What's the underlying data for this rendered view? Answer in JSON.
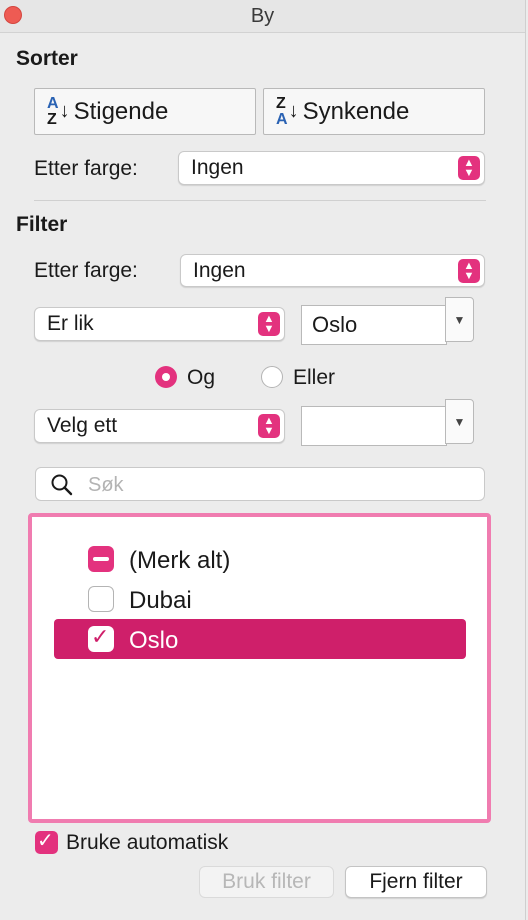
{
  "window": {
    "title": "By"
  },
  "sort": {
    "heading": "Sorter",
    "ascending_label": "Stigende",
    "descending_label": "Synkende",
    "by_color_label": "Etter farge:",
    "by_color_value": "Ingen"
  },
  "filter": {
    "heading": "Filter",
    "by_color_label": "Etter farge:",
    "by_color_value": "Ingen",
    "condition1": {
      "operator": "Er lik",
      "value": "Oslo"
    },
    "logic": {
      "and_label": "Og",
      "or_label": "Eller",
      "selected": "Og"
    },
    "condition2": {
      "operator": "Velg ett",
      "value": ""
    }
  },
  "search": {
    "placeholder": "Søk",
    "value": ""
  },
  "list": {
    "items": [
      {
        "label": "(Merk alt)",
        "state": "mixed"
      },
      {
        "label": "Dubai",
        "state": "unchecked"
      },
      {
        "label": "Oslo",
        "state": "checked",
        "selected": true
      }
    ]
  },
  "footer": {
    "auto_apply_label": "Bruke automatisk",
    "auto_apply_checked": true,
    "apply_button": "Bruk filter",
    "clear_button": "Fjern filter"
  },
  "colors": {
    "accent": "#e3327e",
    "selection": "#cf1f6a",
    "focus_ring": "#f07cb0"
  },
  "icons": [
    "close-icon",
    "sort-ascending-icon",
    "sort-descending-icon",
    "stepper-icon",
    "dropdown-arrow-icon",
    "search-icon",
    "checkmark-icon"
  ]
}
